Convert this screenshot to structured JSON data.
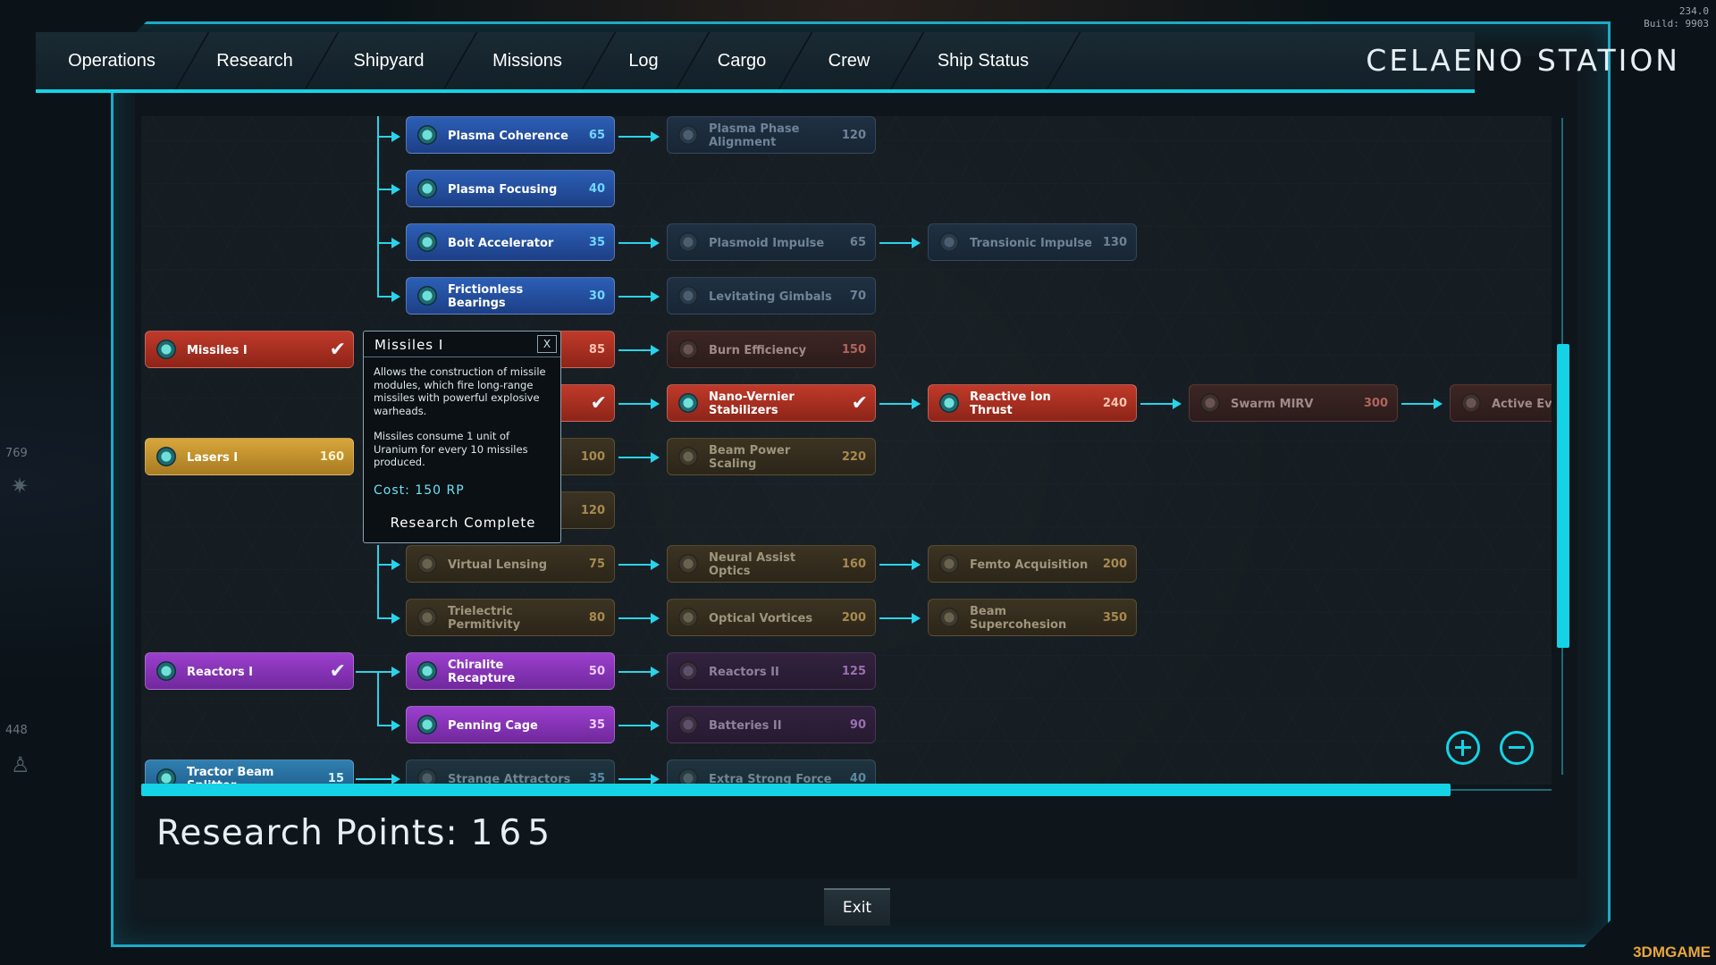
{
  "corner": {
    "line1": "234.0",
    "line2": "Build: 9903"
  },
  "side": {
    "num1": "769",
    "num2": "448"
  },
  "watermark": "3DMGAME",
  "tabs": [
    "Operations",
    "Research",
    "Shipyard",
    "Missions",
    "Log",
    "Cargo",
    "Crew",
    "Ship Status"
  ],
  "station_name": "CELAENO STATION",
  "nodes": [
    {
      "name": "Plasma Coherence",
      "cost": "65"
    },
    {
      "name": "Plasma Phase Alignment",
      "cost": "120"
    },
    {
      "name": "Plasma Focusing",
      "cost": "40"
    },
    {
      "name": "Bolt Accelerator",
      "cost": "35"
    },
    {
      "name": "Plasmoid Impulse",
      "cost": "65"
    },
    {
      "name": "Transionic Impulse",
      "cost": "130"
    },
    {
      "name": "Frictionless Bearings",
      "cost": "30"
    },
    {
      "name": "Levitating Gimbals",
      "cost": "70"
    },
    {
      "name": "Missiles I",
      "cost": ""
    },
    {
      "name": "",
      "cost": "85"
    },
    {
      "name": "Burn Efficiency",
      "cost": "150"
    },
    {
      "name": "",
      "cost": ""
    },
    {
      "name": "Nano-Vernier Stabilizers",
      "cost": ""
    },
    {
      "name": "Reactive Ion Thrust",
      "cost": "240"
    },
    {
      "name": "Swarm MIRV",
      "cost": "300"
    },
    {
      "name": "Active Ev",
      "cost": ""
    },
    {
      "name": "Lasers I",
      "cost": "160"
    },
    {
      "name": "",
      "cost": "100"
    },
    {
      "name": "Beam Power Scaling",
      "cost": "220"
    },
    {
      "name": "",
      "cost": "120"
    },
    {
      "name": "Virtual Lensing",
      "cost": "75"
    },
    {
      "name": "Neural Assist Optics",
      "cost": "160"
    },
    {
      "name": "Femto Acquisition",
      "cost": "200"
    },
    {
      "name": "Trielectric Permitivity",
      "cost": "80"
    },
    {
      "name": "Optical Vortices",
      "cost": "200"
    },
    {
      "name": "Beam Supercohesion",
      "cost": "350"
    },
    {
      "name": "Reactors I",
      "cost": ""
    },
    {
      "name": "Chiralite Recapture",
      "cost": "50"
    },
    {
      "name": "Reactors II",
      "cost": "125"
    },
    {
      "name": "Penning Cage",
      "cost": "35"
    },
    {
      "name": "Batteries II",
      "cost": "90"
    },
    {
      "name": "Tractor Beam Splitter",
      "cost": "15"
    },
    {
      "name": "Strange Attractors",
      "cost": "35"
    },
    {
      "name": "Extra Strong Force",
      "cost": "40"
    }
  ],
  "tooltip": {
    "title": "Missiles I",
    "close": "X",
    "desc1": "Allows the construction of missile modules, which fire long-range missiles with powerful explosive warheads.",
    "desc2": "Missiles consume 1 unit of Uranium for every 10 missiles produced.",
    "cost": "Cost: 150 RP",
    "status": "Research Complete"
  },
  "research_points": {
    "label": "Research Points:",
    "value": "165"
  },
  "exit_label": "Exit",
  "colors": {
    "accent": "#14d3e6",
    "blue": "#2c5fb6",
    "red": "#c03a2a",
    "gold": "#d8a63a",
    "purple": "#9c3fce"
  }
}
